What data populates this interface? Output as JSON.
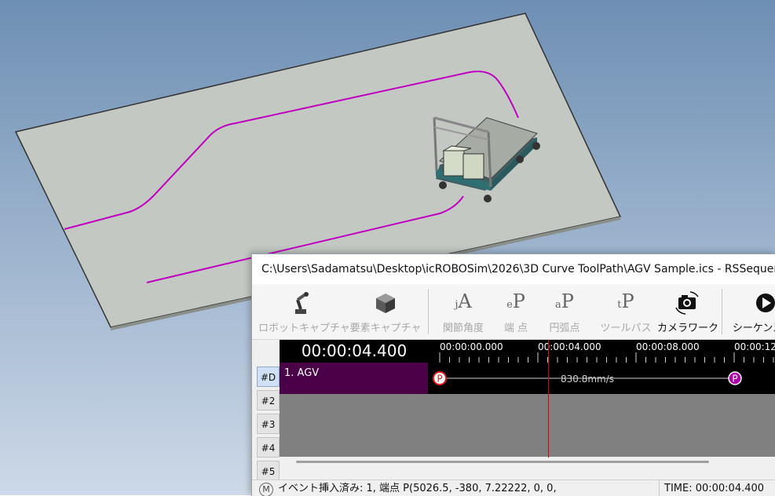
{
  "window": {
    "title": "C:\\Users\\Sadamatsu\\Desktop\\icROBOSim\\2026\\3D Curve ToolPath\\AGV Sample.ics - RSSequencer"
  },
  "toolbar": {
    "buttons": [
      {
        "label": "ロボットキャプチャ",
        "enabled": false,
        "icon": "robot-arm-icon"
      },
      {
        "label": "要素キャプチャ",
        "enabled": false,
        "icon": "cube-icon"
      },
      {
        "label": "関節角度",
        "enabled": false,
        "glyph": "jA"
      },
      {
        "label": "端 点",
        "enabled": false,
        "glyph": "eP"
      },
      {
        "label": "円弧点",
        "enabled": false,
        "glyph": "aP"
      },
      {
        "label": "ツールパス",
        "enabled": false,
        "glyph": "tP"
      },
      {
        "label": "カメラワーク",
        "enabled": true,
        "icon": "camera-icon"
      },
      {
        "label": "シーケンス",
        "enabled": true,
        "icon": "play-icon"
      }
    ]
  },
  "timeline": {
    "current_time": "00:00:04.400",
    "ruler_ticks": [
      "00:00:00.000",
      "00:00:04.000",
      "00:00:08.000",
      "00:00:12"
    ],
    "tracks": [
      "#D",
      "#2",
      "#3",
      "#4",
      "#5"
    ],
    "track1": {
      "name": "1. AGV",
      "speed": "830.8mm/s",
      "markers": [
        "P",
        "P"
      ]
    }
  },
  "status": {
    "icon": "M",
    "message": "イベント挿入済み: 1, 端点 P(5026.5, -380, 7.22222, 0, 0,",
    "time": "TIME: 00:00:04.400"
  },
  "colors": {
    "background_gradient_top": "#6f90b5",
    "background_gradient_bottom": "#c9d6e6",
    "floor": "#c4c9c4",
    "path": "#c000c0",
    "agv_track": "#4a0046",
    "playhead": "#e00000",
    "marker_start": "#e02020",
    "marker_end": "#b000b0"
  }
}
